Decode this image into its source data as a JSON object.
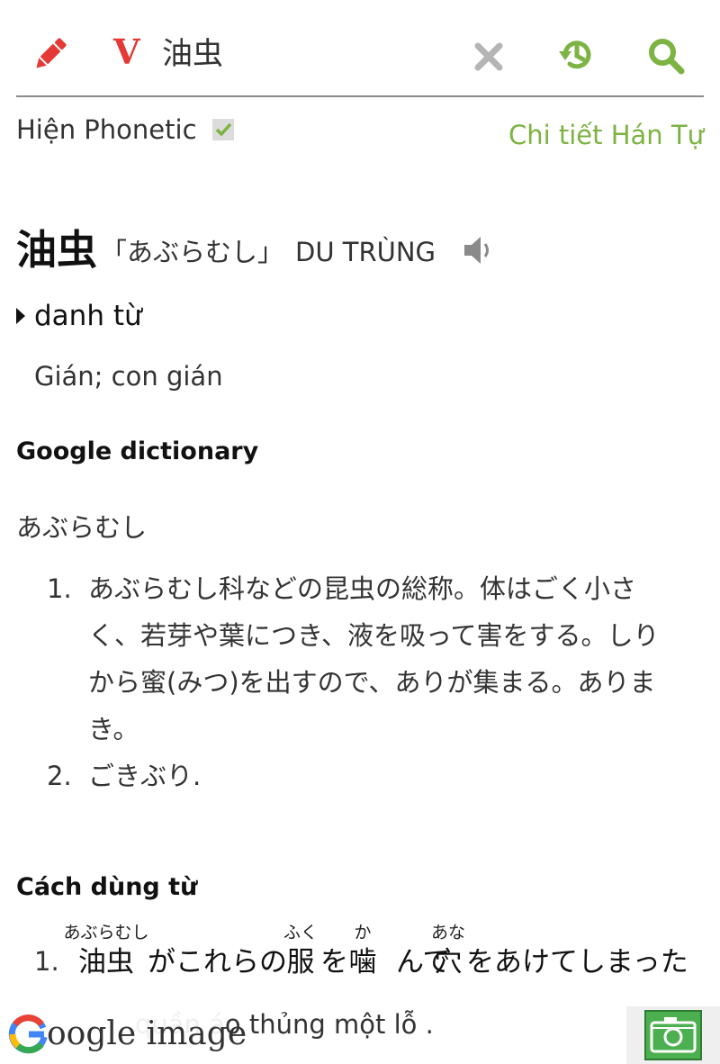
{
  "search": {
    "lang_label": "V",
    "query": "油虫"
  },
  "options": {
    "phonetic_label": "Hiện Phonetic",
    "phonetic_checked": true,
    "hantu_link": "Chi tiết Hán Tự"
  },
  "entry": {
    "kanji": "油虫",
    "reading": "「あぶらむし」",
    "hanviet": "DU TRÙNG",
    "part_of_speech": "danh từ",
    "meaning": "Gián; con gián"
  },
  "google_dictionary": {
    "heading": "Google dictionary",
    "word": "あぶらむし",
    "definitions": [
      {
        "num": "1.",
        "lines": [
          "あぶらむし科などの昆虫の総称。体はごく小さ",
          "く、若芽や葉につき、液を吸って害をする。しり",
          "から蜜(みつ)を出すので、ありが集まる。ありま",
          "き。"
        ]
      },
      {
        "num": "2.",
        "lines": [
          "ごきぶり."
        ]
      }
    ]
  },
  "usage": {
    "heading": "Cách dùng từ",
    "examples": [
      {
        "num": "1.",
        "ruby": [
          {
            "furigana": "あぶらむし",
            "base": "油虫"
          },
          {
            "furigana": "ふく",
            "base": "服"
          },
          {
            "furigana": "か",
            "base": "噛"
          },
          {
            "furigana": "あな",
            "base": "穴"
          }
        ],
        "text_parts": [
          "がこれらの",
          "を",
          "んで",
          "をあけてしまった"
        ],
        "translation": "quần áo thủng một lỗ ."
      }
    ]
  },
  "overlay": {
    "google_image_label": "oogle image"
  },
  "colors": {
    "accent_green": "#7cb342",
    "red": "#e53935",
    "camera_green": "#4caf50"
  },
  "icons": {
    "edit": "pencil-icon",
    "clear": "close-icon",
    "history": "history-icon",
    "search": "search-icon",
    "check": "check-icon",
    "audio": "speaker-icon",
    "camera": "camera-icon"
  }
}
